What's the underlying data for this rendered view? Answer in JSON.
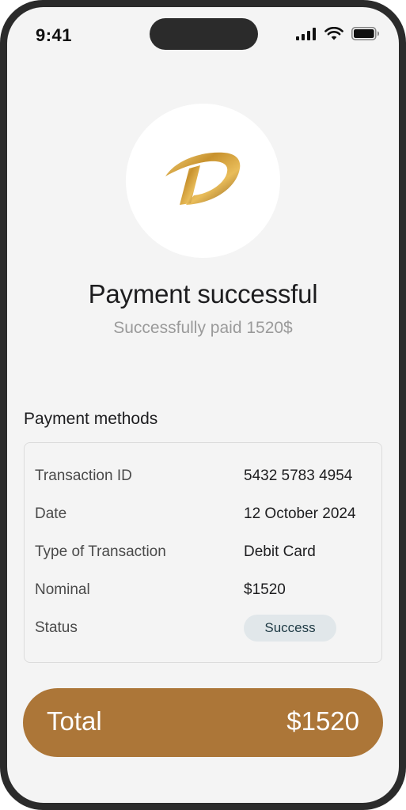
{
  "status_bar": {
    "time": "9:41"
  },
  "colors": {
    "accent": "#ac7638",
    "badge_bg": "#e1e7ea",
    "screen_bg": "#f4f4f4"
  },
  "logo": {
    "icon": "gold-d-logo-icon"
  },
  "header": {
    "title": "Payment successful",
    "subtitle": "Successfully paid 1520$"
  },
  "details": {
    "section_title": "Payment methods",
    "rows": [
      {
        "label": "Transaction ID",
        "value": "5432 5783 4954"
      },
      {
        "label": "Date",
        "value": "12 October 2024"
      },
      {
        "label": "Type of Transaction",
        "value": "Debit Card"
      },
      {
        "label": "Nominal",
        "value": "$1520"
      },
      {
        "label": "Status",
        "value": "Success"
      }
    ]
  },
  "total": {
    "label": "Total",
    "value": "$1520"
  }
}
